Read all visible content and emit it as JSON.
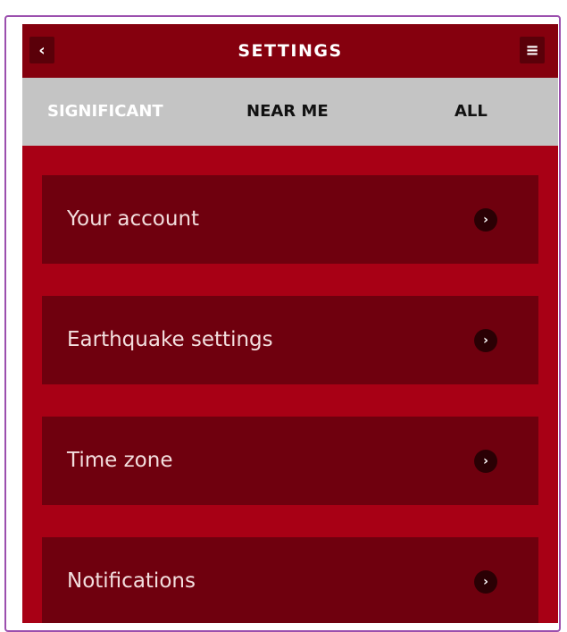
{
  "header": {
    "title": "SETTINGS",
    "back_icon": "‹",
    "menu_icon": "≡"
  },
  "tabs": [
    {
      "label": "SIGNIFICANT",
      "active": true
    },
    {
      "label": "NEAR ME",
      "active": false
    },
    {
      "label": "ALL",
      "active": false
    }
  ],
  "menu": {
    "items": [
      {
        "label": "Your account"
      },
      {
        "label": "Earthquake settings"
      },
      {
        "label": "Time zone"
      },
      {
        "label": "Notifications"
      }
    ],
    "chevron_icon": "›"
  },
  "colors": {
    "background": "#a80015",
    "header": "#85000e",
    "tab_bar": "#c4c4c4",
    "menu_item": "#6f000e",
    "frame_border": "#9b4fae"
  }
}
